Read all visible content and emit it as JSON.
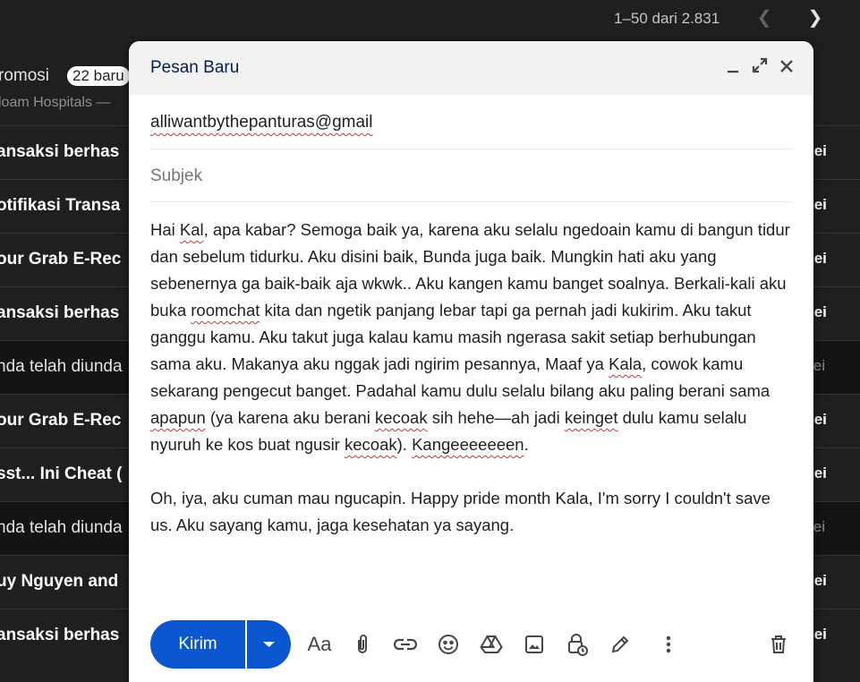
{
  "pager": {
    "range": "1–50 dari 2.831"
  },
  "promo": {
    "title": "romosi",
    "badge": "22 baru",
    "subtitle": "loam Hospitals —"
  },
  "rows": [
    {
      "sender": "ansaksi berhas",
      "date": "lei"
    },
    {
      "sender": "otifikasi Transa",
      "date": "lei"
    },
    {
      "sender": "our Grab E-Rec",
      "date": "lei"
    },
    {
      "sender": "ansaksi berhas",
      "date": "lei"
    },
    {
      "sender": "nda telah diunda",
      "date": "lei"
    },
    {
      "sender": "our Grab E-Rec",
      "date": "lei"
    },
    {
      "sender": "sst... Ini Cheat (",
      "date": "lei"
    },
    {
      "sender": "nda telah diunda",
      "date": "lei"
    },
    {
      "sender": "uy Nguyen and",
      "date": "lei"
    },
    {
      "sender": "ansaksi berhas",
      "date": "lei"
    }
  ],
  "compose": {
    "title": "Pesan Baru",
    "to": "alliwantbythepanturas@gmail",
    "subject_placeholder": "Subjek",
    "body": {
      "p1_a": "Hai ",
      "p1_kal": "Kal",
      "p1_b": ", apa kabar? Semoga baik ya, karena aku selalu ngedoain kamu di bangun tidur dan sebelum tidurku. Aku disini baik, Bunda juga baik. Mungkin hati aku yang sebenernya ga baik-baik aja wkwk.. Aku kangen kamu banget soalnya. Berkali-kali aku buka ",
      "p1_roomchat": "roomchat",
      "p1_c": " kita dan ngetik panjang lebar tapi ga pernah jadi kukirim. Aku takut ganggu kamu. Aku takut juga kalau kamu masih ngerasa sakit setiap berhubungan sama aku. Makanya aku nggak jadi ngirim pesannya, Maaf ya ",
      "p1_kala": "Kala",
      "p1_d": ", cowok kamu sekarang pengecut banget. Padahal kamu dulu selalu bilang aku paling berani sama ",
      "p1_apapun": "apapun",
      "p1_e": " (ya karena aku berani ",
      "p1_kecoak1": "kecoak",
      "p1_f": " sih hehe—ah jadi ",
      "p1_keinget": "keinget",
      "p1_g": " dulu kamu selalu nyuruh ke kos buat ngusir ",
      "p1_kecoak2": "kecoak",
      "p1_h": "). ",
      "p1_kangen": "Kangeeeeeeen",
      "p1_i": ".",
      "p2": "Oh, iya, aku cuman mau ngucapin. Happy pride month Kala,  I'm sorry I couldn't save us. Aku sayang kamu, jaga kesehatan ya sayang."
    },
    "send_label": "Kirim",
    "format_label": "Aa"
  },
  "colors": {
    "accent": "#0b57d0",
    "spell": "#d93025",
    "dark_bg": "#1f1f1f"
  }
}
